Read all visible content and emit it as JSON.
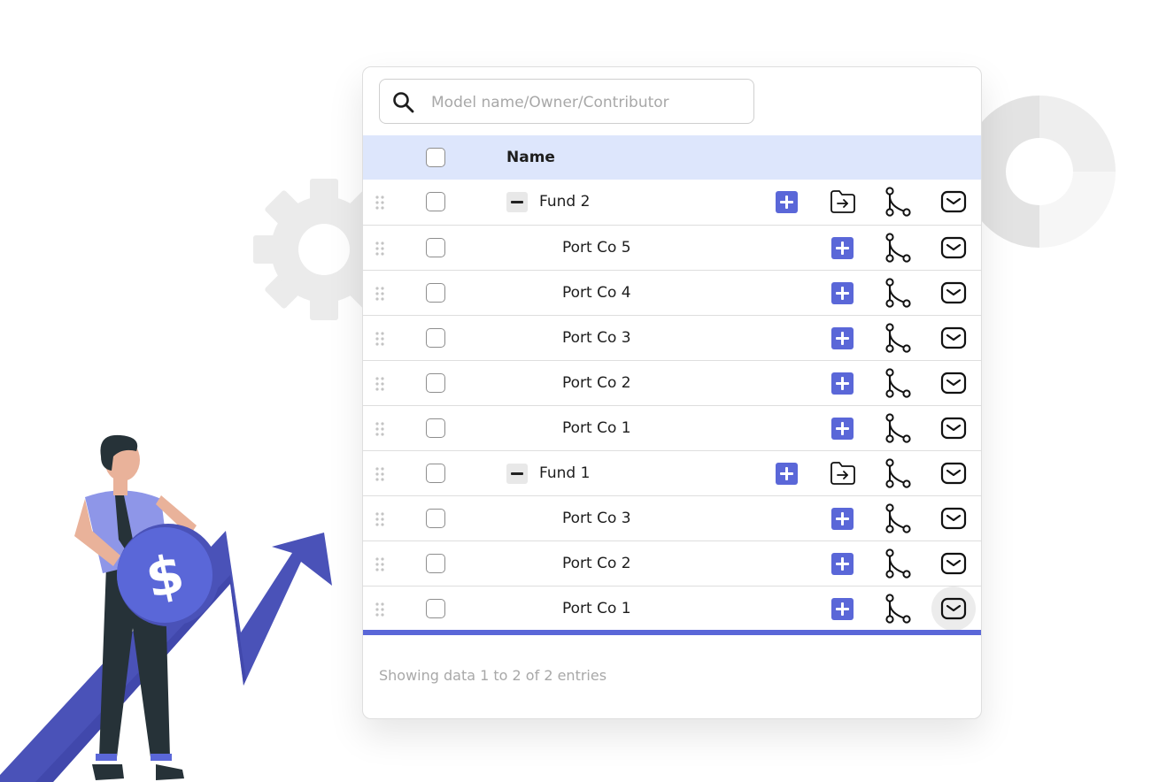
{
  "search": {
    "placeholder": "Model name/Owner/Contributor",
    "icon": "search-icon"
  },
  "header": {
    "name_label": "Name"
  },
  "rows": [
    {
      "type": "fund",
      "label": "Fund 2"
    },
    {
      "type": "child",
      "label": "Port Co 5"
    },
    {
      "type": "child",
      "label": "Port Co 4"
    },
    {
      "type": "child",
      "label": "Port Co 3"
    },
    {
      "type": "child",
      "label": "Port Co 2"
    },
    {
      "type": "child",
      "label": "Port Co 1"
    },
    {
      "type": "fund",
      "label": "Fund 1"
    },
    {
      "type": "child",
      "label": "Port Co 3"
    },
    {
      "type": "child",
      "label": "Port Co 2"
    },
    {
      "type": "child",
      "label": "Port Co 1",
      "hovered_action": "mail"
    }
  ],
  "footer": {
    "text": "Showing data 1 to 2 of 2 entries"
  },
  "colors": {
    "accent": "#5a67d8",
    "header_bg": "#dde6fc",
    "illustration_arrow": "#4a52b8"
  },
  "icons": [
    "drag-handle-icon",
    "plus-icon",
    "folder-move-icon",
    "branch-icon",
    "mail-icon",
    "gear-icon",
    "donut-chart-icon"
  ]
}
